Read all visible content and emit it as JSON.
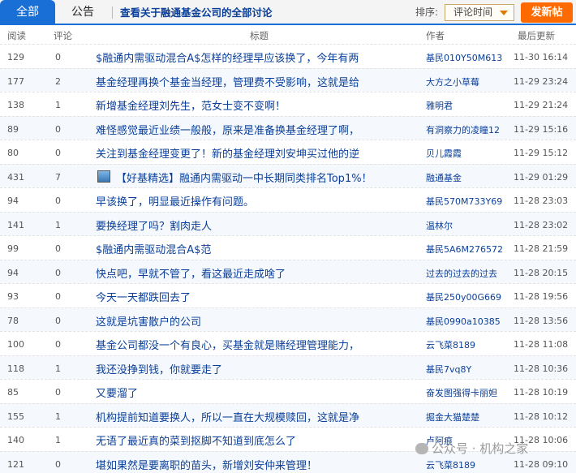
{
  "topbar": {
    "tab_all": "全部",
    "tab_notice": "公告",
    "view_all_text": "查看关于融通基金公司的全部讨论",
    "sort_label": "排序:",
    "sort_value": "评论时间",
    "post_button": "发新帖"
  },
  "table": {
    "headers": {
      "read": "阅读",
      "comments": "评论",
      "title": "标题",
      "author": "作者",
      "updated": "最后更新"
    },
    "rows": [
      {
        "read": "129",
        "comments": "0",
        "title": "$融通内需驱动混合A$怎样的经理早应该换了，今年有两",
        "author": "基民010Y50M613",
        "time": "11-30 16:14"
      },
      {
        "read": "177",
        "comments": "2",
        "title": "基金经理再换个基金当经理，管理费不受影响，这就是给",
        "author": "大方之小草莓",
        "time": "11-29 23:24"
      },
      {
        "read": "138",
        "comments": "1",
        "title": "新增基金经理刘先生，范女士变不变啊！",
        "author": "雅明君",
        "time": "11-29 21:24"
      },
      {
        "read": "89",
        "comments": "0",
        "title": "难怪感觉最近业绩一般般，原来是准备换基金经理了啊，",
        "author": "有洞察力的凌瞳12",
        "time": "11-29 15:16"
      },
      {
        "read": "80",
        "comments": "0",
        "title": "关注到基金经理变更了！新的基金经理刘安坤买过他的逆",
        "author": "贝儿霞霞",
        "time": "11-29 15:12"
      },
      {
        "read": "431",
        "comments": "7",
        "title": "【好基精选】融通内需驱动一中长期同类排名Top1%！",
        "author": "融通基金",
        "time": "11-29 01:29",
        "icon": "image-icon"
      },
      {
        "read": "94",
        "comments": "0",
        "title": "早该换了，明显最近操作有问题。",
        "author": "基民570M733Y69",
        "time": "11-28 23:03"
      },
      {
        "read": "141",
        "comments": "1",
        "title": "要换经理了吗？割肉走人",
        "author": "温林尔",
        "time": "11-28 23:02"
      },
      {
        "read": "99",
        "comments": "0",
        "title": "$融通内需驱动混合A$范",
        "author": "基民5A6M276572",
        "time": "11-28 21:59"
      },
      {
        "read": "94",
        "comments": "0",
        "title": "快点吧，早就不管了，看这最近走成啥了",
        "author": "过去的过去的过去",
        "time": "11-28 20:15"
      },
      {
        "read": "93",
        "comments": "0",
        "title": "今天一天都跌回去了",
        "author": "基民250y00G669",
        "time": "11-28 19:56"
      },
      {
        "read": "78",
        "comments": "0",
        "title": "这就是坑害散户的公司",
        "author": "基民0990a10385",
        "time": "11-28 13:56"
      },
      {
        "read": "100",
        "comments": "0",
        "title": "基金公司都没一个有良心，买基金就是赌经理管理能力，",
        "author": "云飞菜8189",
        "time": "11-28 11:08"
      },
      {
        "read": "118",
        "comments": "1",
        "title": "我还没挣到钱，你就要走了",
        "author": "基民7vq8Y",
        "time": "11-28 10:36"
      },
      {
        "read": "85",
        "comments": "0",
        "title": "又要溜了",
        "author": "奋发图强得卡丽妲",
        "time": "11-28 10:19"
      },
      {
        "read": "155",
        "comments": "1",
        "title": "机构提前知道要换人，所以一直在大规模赎回，这就是净",
        "author": "掘金大猫楚楚",
        "time": "11-28 10:12"
      },
      {
        "read": "140",
        "comments": "1",
        "title": "无语了最近真的菜到抠脚不知道到底怎么了",
        "author": "卢阿痕",
        "time": "11-28 10:06"
      },
      {
        "read": "121",
        "comments": "0",
        "title": "堪如果然是要离职的苗头，新增刘安仲来管理！",
        "author": "云飞菜8189",
        "time": "11-28 09:10"
      }
    ]
  },
  "watermark": {
    "text": "公众号 · 机构之家"
  },
  "colors": {
    "accent": "#1a6fd6",
    "post_button": "#ff6a00",
    "link": "#0a3f99"
  }
}
